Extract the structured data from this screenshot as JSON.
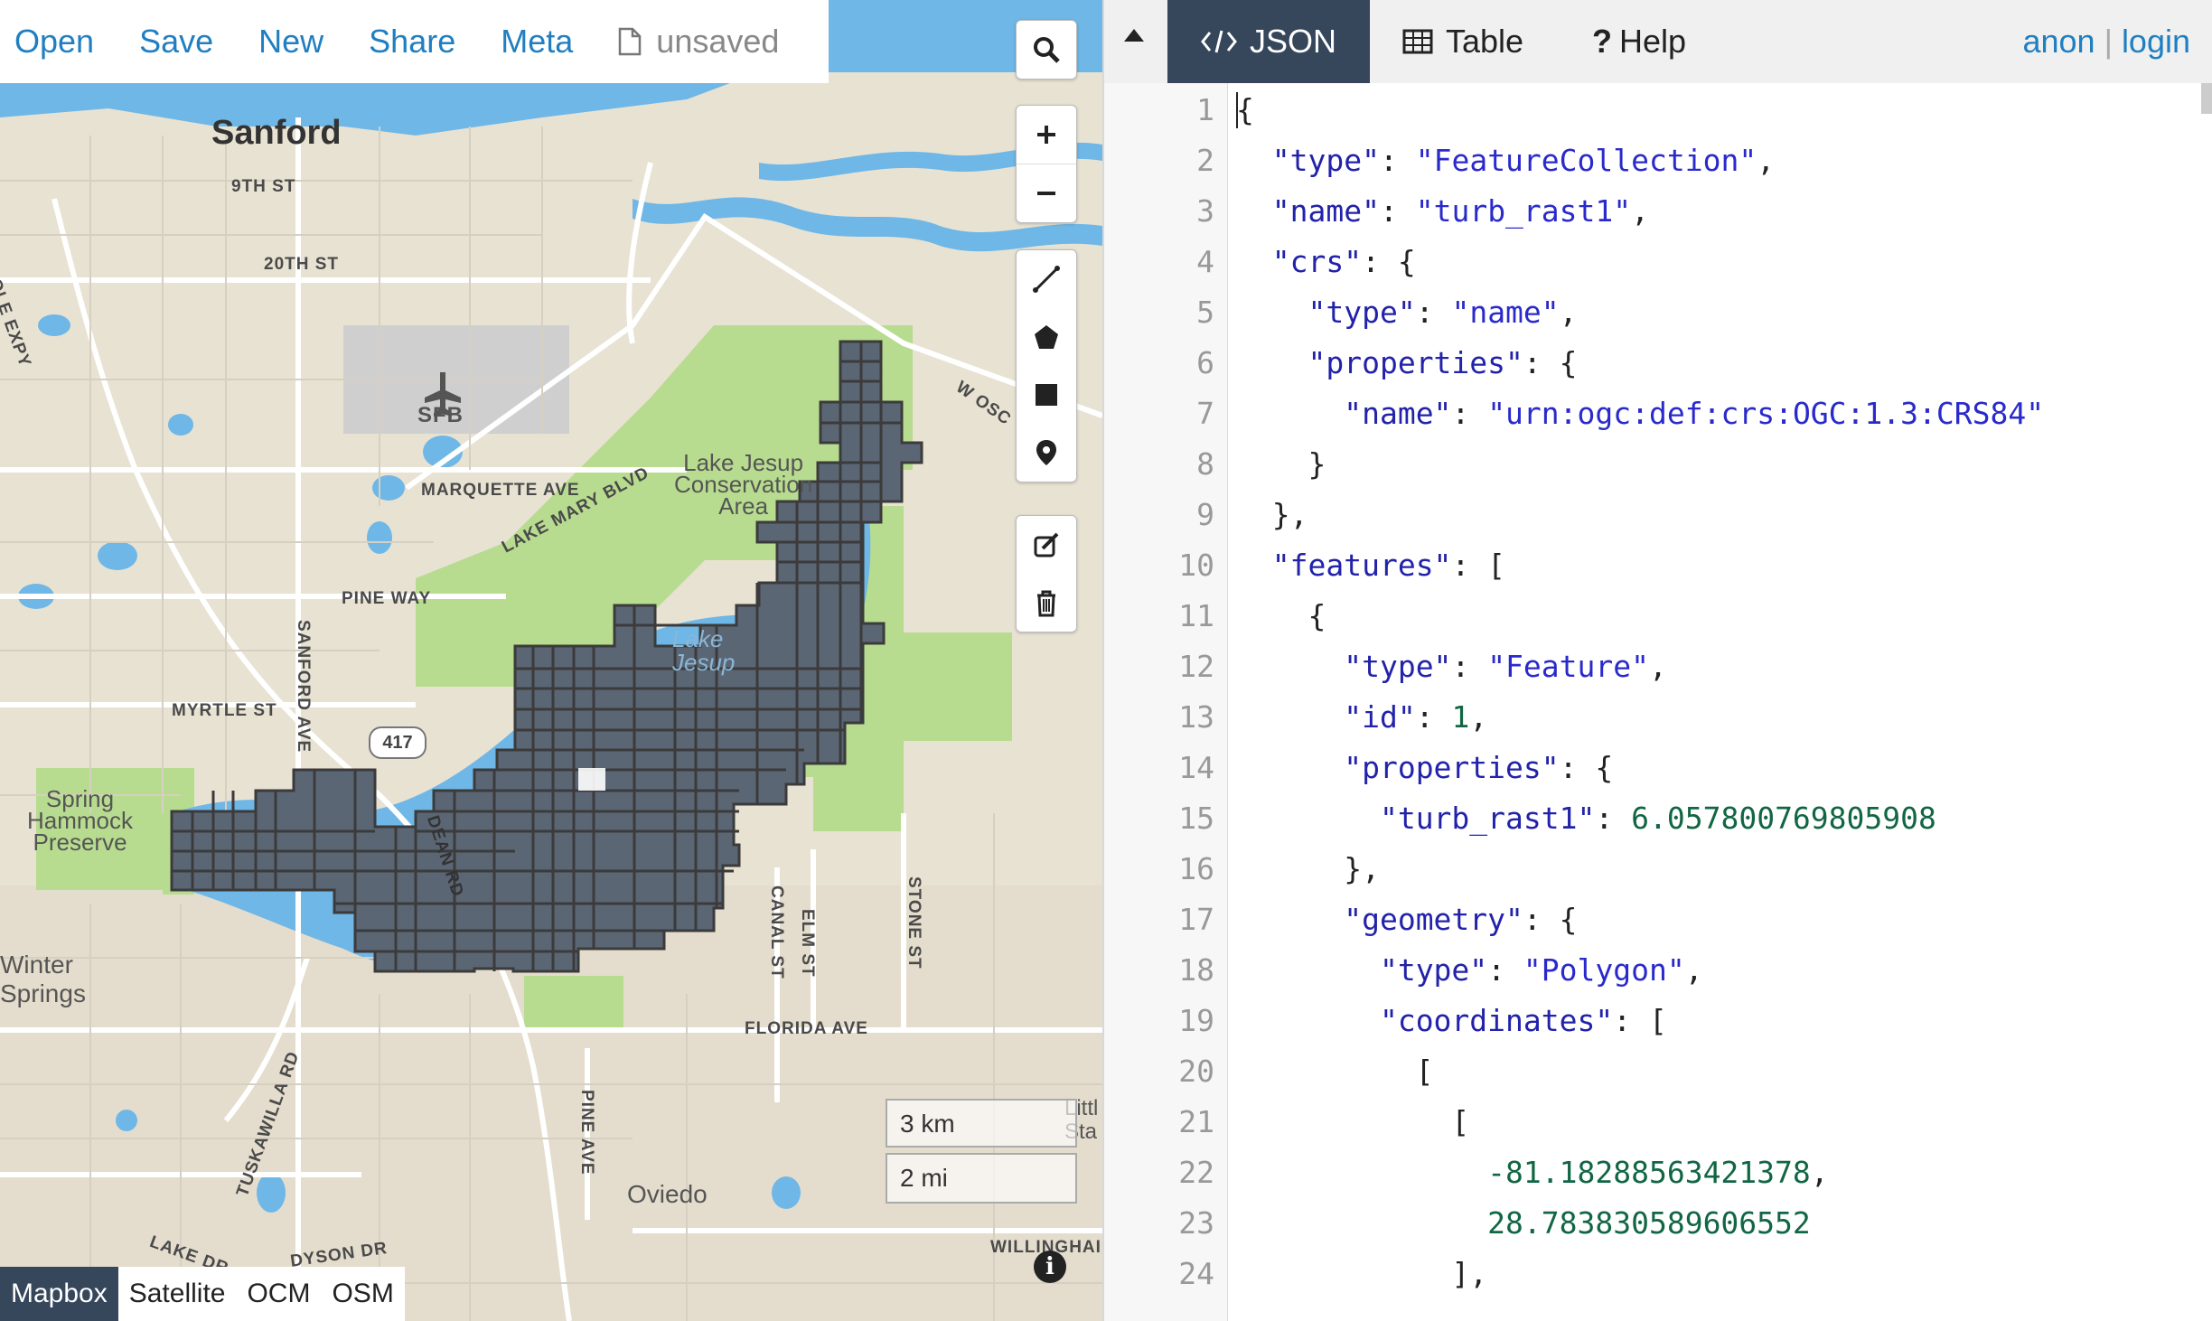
{
  "menu": {
    "items": [
      "Open",
      "Save",
      "New",
      "Share",
      "Meta"
    ],
    "file_status": "unsaved"
  },
  "map": {
    "place_labels": {
      "sanford": "Sanford",
      "sfb": "SFB",
      "lake_jesup_area": [
        "Lake Jesup",
        "Conservation",
        "Area"
      ],
      "spring_hammock": [
        "Spring",
        "Hammock",
        "Preserve"
      ],
      "winter_springs": [
        "Winter",
        "Springs"
      ],
      "oviedo": "Oviedo",
      "lake_jesup_water": [
        "Lake",
        "Jesup"
      ],
      "little": [
        "Littl",
        "Sta"
      ]
    },
    "street_labels": {
      "ninth": "9TH ST",
      "twentieth": "20TH ST",
      "seminole": "MINOLE EXPY",
      "marquette": "MARQUETTE AVE",
      "lake_mary": "LAKE MARY BLVD",
      "pine_way": "PINE WAY",
      "myrtle": "MYRTLE ST",
      "sanford_ave": "SANFORD AVE",
      "route": "417",
      "canal": "CANAL ST",
      "elm": "ELM ST",
      "stone": "STONE ST",
      "florida": "FLORIDA AVE",
      "tuskawilla": "TUSKAWILLA RD",
      "pine_ave": "PINE AVE",
      "lake_dr": "LAKE DR",
      "dyson": "DYSON DR",
      "w_osc": "W OSC",
      "willingham": "WILLINGHAI",
      "dean": "DEAN RD"
    },
    "scale": {
      "km": "3 km",
      "mi": "2 mi"
    },
    "layers": [
      "Mapbox",
      "Satellite",
      "OCM",
      "OSM"
    ],
    "active_layer": "Mapbox",
    "info": "i"
  },
  "tabs": [
    {
      "label": "JSON",
      "active": true
    },
    {
      "label": "Table",
      "active": false
    },
    {
      "label": "Help",
      "active": false
    }
  ],
  "auth": {
    "anon": "anon",
    "login": "login",
    "separator": "|"
  },
  "editor_lines": [
    "{",
    "  \"type\": \"FeatureCollection\",",
    "  \"name\": \"turb_rast1\",",
    "  \"crs\": {",
    "    \"type\": \"name\",",
    "    \"properties\": {",
    "      \"name\": \"urn:ogc:def:crs:OGC:1.3:CRS84\"",
    "    }",
    "  },",
    "  \"features\": [",
    "    {",
    "      \"type\": \"Feature\",",
    "      \"id\": 1,",
    "      \"properties\": {",
    "        \"turb_rast1\": 6.057800769805908",
    "      },",
    "      \"geometry\": {",
    "        \"type\": \"Polygon\",",
    "        \"coordinates\": [",
    "          [",
    "            [",
    "              -81.18288563421378,",
    "              28.783830589606552",
    "            ],"
  ],
  "colors": {
    "map_background": "#ebe6d8",
    "water": "#6fb7e6",
    "park": "#b8dc8f",
    "grid_fill": "#5b6675",
    "grid_stroke": "#3b3b3b",
    "active_tab": "#36465b",
    "link": "#1f7fc1"
  }
}
